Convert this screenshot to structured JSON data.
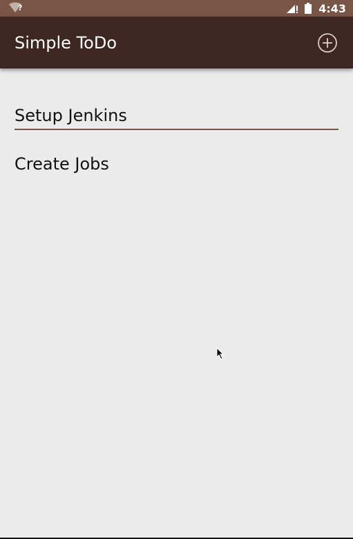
{
  "status_bar": {
    "wifi_icon": "wifi-unknown-icon",
    "wifi_symbol": "?",
    "signal_icon": "signal-no-data-icon",
    "battery_icon": "battery-full-icon",
    "time": "4:43",
    "color": "#795548"
  },
  "app_bar": {
    "title": "Simple ToDo",
    "add_icon": "add-circle-icon",
    "color": "#3e2723"
  },
  "todos": [
    {
      "label": "Setup Jenkins",
      "state": "editing"
    },
    {
      "label": "Create Jobs",
      "state": "normal"
    }
  ],
  "accent": "#795548",
  "background": "#ebebeb"
}
